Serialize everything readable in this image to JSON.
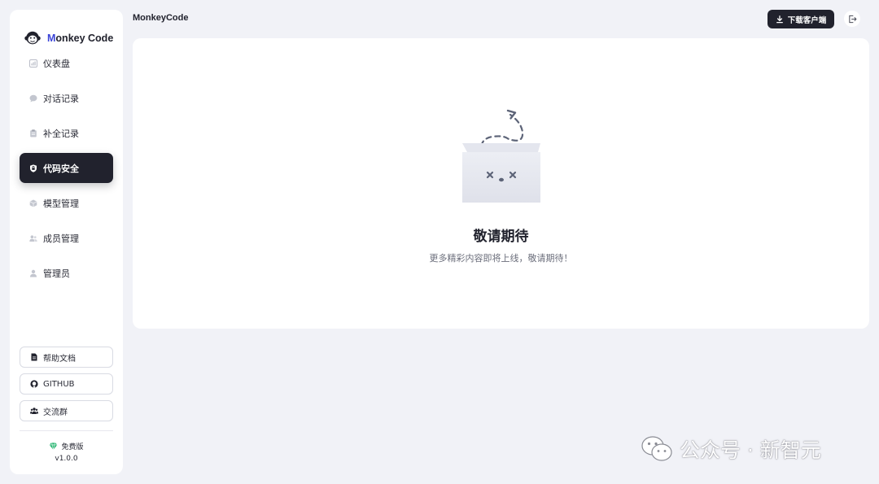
{
  "brand": {
    "name_first": "M",
    "name_rest": "onkey Code"
  },
  "header": {
    "title": "MonkeyCode",
    "download_label": "下载客户端"
  },
  "sidebar": {
    "items": [
      {
        "label": "仪表盘",
        "icon": "dashboard-icon",
        "active": false
      },
      {
        "label": "对话记录",
        "icon": "chat-icon",
        "active": false
      },
      {
        "label": "补全记录",
        "icon": "clipboard-icon",
        "active": false
      },
      {
        "label": "代码安全",
        "icon": "shield-icon",
        "active": true
      },
      {
        "label": "模型管理",
        "icon": "cube-icon",
        "active": false
      },
      {
        "label": "成员管理",
        "icon": "users-icon",
        "active": false
      },
      {
        "label": "管理员",
        "icon": "user-icon",
        "active": false
      }
    ],
    "links": [
      {
        "label": "帮助文档",
        "icon": "document-icon"
      },
      {
        "label": "GITHUB",
        "icon": "github-icon"
      },
      {
        "label": "交流群",
        "icon": "group-icon"
      }
    ],
    "plan_label": "免费版",
    "version": "v1.0.0"
  },
  "main": {
    "empty_title": "敬请期待",
    "empty_description": "更多精彩内容即将上线，敬请期待！"
  },
  "watermark": {
    "text": "公众号 · 新智元"
  },
  "colors": {
    "background": "#f1f2f7",
    "dark": "#21222d",
    "brand_accent": "#3b44d8",
    "plan_green": "#2bb673"
  }
}
